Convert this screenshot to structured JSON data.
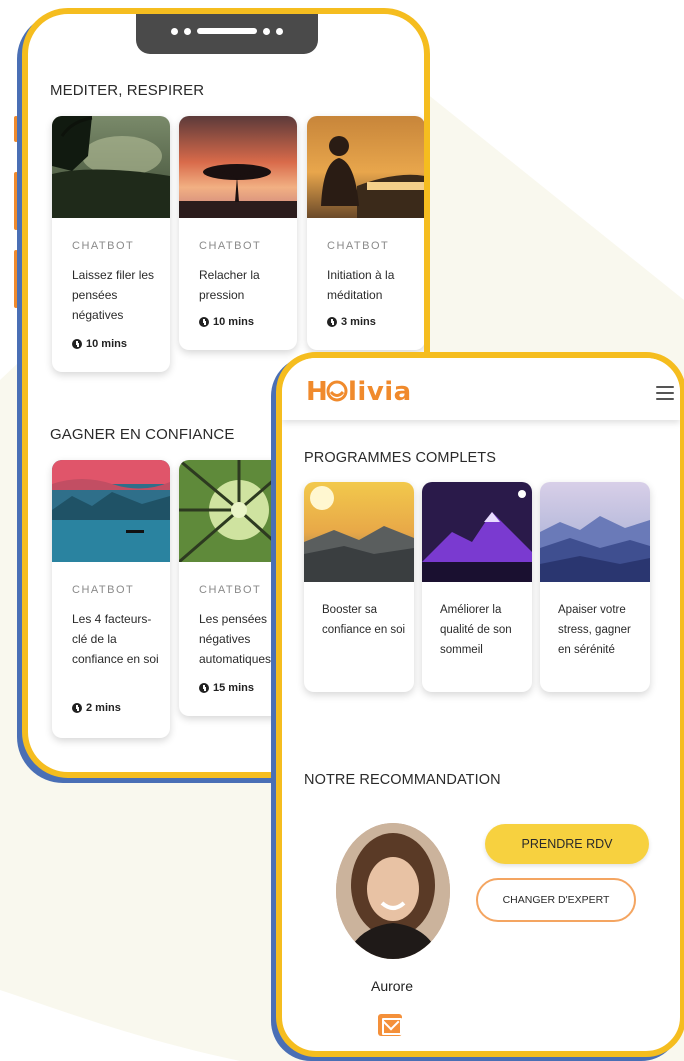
{
  "back_phone": {
    "section1_title": "MEDITER, RESPIRER",
    "section1_cards": [
      {
        "tag": "CHATBOT",
        "title": "Laissez filer les pensées négatives",
        "duration": "10 mins"
      },
      {
        "tag": "CHATBOT",
        "title": "Relacher la pression",
        "duration": "10 mins"
      },
      {
        "tag": "CHATBOT",
        "title": "Initiation à la méditation",
        "duration": "3 mins"
      }
    ],
    "section2_title": "GAGNER EN CONFIANCE",
    "section2_cards": [
      {
        "tag": "CHATBOT",
        "title": "Les 4 facteurs-clé de la confiance en soi",
        "duration": "2 mins"
      },
      {
        "tag": "CHATBOT",
        "title": "Les pensées négatives automatiques",
        "duration": "15 mins"
      }
    ]
  },
  "front_phone": {
    "logo": "Holivia",
    "programs_title": "PROGRAMMES COMPLETS",
    "programs": [
      {
        "title": "Booster sa confiance en soi"
      },
      {
        "title": "Améliorer la qualité de son sommeil"
      },
      {
        "title": "Apaiser votre stress, gagner en sérénité"
      }
    ],
    "recommendation_title": "NOTRE RECOMMANDATION",
    "expert_name": "Aurore",
    "btn_rdv": "PRENDRE RDV",
    "btn_change": "CHANGER D'EXPERT"
  },
  "colors": {
    "frame": "#f5bd1f",
    "frame_shadow": "#4a6fb5",
    "brand": "#f08a2c",
    "button_primary": "#f7d13f",
    "button_outline": "#f4a561"
  },
  "icons": [
    "clock-icon",
    "menu-icon",
    "mail-icon",
    "holivia-logo"
  ]
}
